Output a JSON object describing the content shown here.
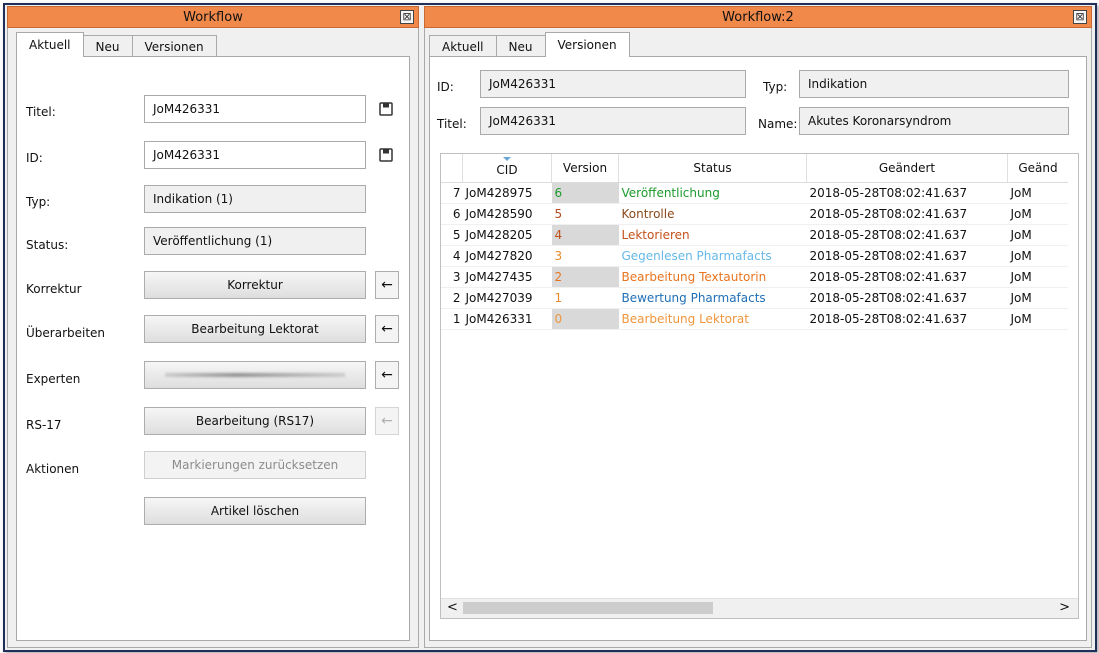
{
  "left": {
    "title": "Workflow",
    "close": "⊠",
    "tabs": [
      "Aktuell",
      "Neu",
      "Versionen"
    ],
    "form": {
      "titel_label": "Titel:",
      "titel_value": "JoM426331",
      "id_label": "ID:",
      "id_value": "JoM426331",
      "typ_label": "Typ:",
      "typ_value": "Indikation (1)",
      "status_label": "Status:",
      "status_value": "Veröffentlichung (1)",
      "korrektur_label": "Korrektur",
      "korrektur_button": "Korrektur",
      "ueberarbeiten_label": "Überarbeiten",
      "ueberarbeiten_button": "Bearbeitung Lektorat",
      "experten_label": "Experten",
      "rs17_label": "RS-17",
      "rs17_button": "Bearbeitung (RS17)",
      "aktionen_label": "Aktionen",
      "aktionen_button": "Markierungen zurücksetzen",
      "loeschen_button": "Artikel löschen",
      "arrow": "←"
    }
  },
  "right": {
    "title": "Workflow:2",
    "close": "⊠",
    "tabs": [
      "Aktuell",
      "Neu",
      "Versionen"
    ],
    "header": {
      "id_label": "ID:",
      "id_value": "JoM426331",
      "typ_label": "Typ:",
      "typ_value": "Indikation",
      "titel_label": "Titel:",
      "titel_value": "JoM426331",
      "name_label": "Name:",
      "name_value": "Akutes Koronarsyndrom"
    },
    "table": {
      "columns": [
        "CID",
        "Version",
        "Status",
        "Geändert",
        "Geänd"
      ],
      "rows": [
        {
          "idx": "7",
          "cid": "JoM428975",
          "version": "6",
          "status": "Veröffentlichung",
          "changed": "2018-05-28T08:02:41.637",
          "by": "JoM",
          "color": "#1e9a2c",
          "vcolor": "#1e9a2c"
        },
        {
          "idx": "6",
          "cid": "JoM428590",
          "version": "5",
          "status": "Kontrolle",
          "changed": "2018-05-28T08:02:41.637",
          "by": "JoM",
          "color": "#8b4a1c",
          "vcolor": "#b44a1c"
        },
        {
          "idx": "5",
          "cid": "JoM428205",
          "version": "4",
          "status": "Lektorieren",
          "changed": "2018-05-28T08:02:41.637",
          "by": "JoM",
          "color": "#c4511b",
          "vcolor": "#c4511b"
        },
        {
          "idx": "4",
          "cid": "JoM427820",
          "version": "3",
          "status": "Gegenlesen Pharmafacts",
          "changed": "2018-05-28T08:02:41.637",
          "by": "JoM",
          "color": "#66b8e8",
          "vcolor": "#e88b2a"
        },
        {
          "idx": "3",
          "cid": "JoM427435",
          "version": "2",
          "status": "Bearbeitung Textautorin",
          "changed": "2018-05-28T08:02:41.637",
          "by": "JoM",
          "color": "#e8741e",
          "vcolor": "#e8741e"
        },
        {
          "idx": "2",
          "cid": "JoM427039",
          "version": "1",
          "status": "Bewertung Pharmafacts",
          "changed": "2018-05-28T08:02:41.637",
          "by": "JoM",
          "color": "#1f6fb6",
          "vcolor": "#e88b2a"
        },
        {
          "idx": "1",
          "cid": "JoM426331",
          "version": "0",
          "status": "Bearbeitung Lektorat",
          "changed": "2018-05-28T08:02:41.637",
          "by": "JoM",
          "color": "#f0963c",
          "vcolor": "#f0963c"
        }
      ]
    },
    "scroll_left": "<",
    "scroll_right": ">"
  },
  "colors": {
    "titlebar": "#f0894a",
    "frame": "#1f2f5a"
  }
}
